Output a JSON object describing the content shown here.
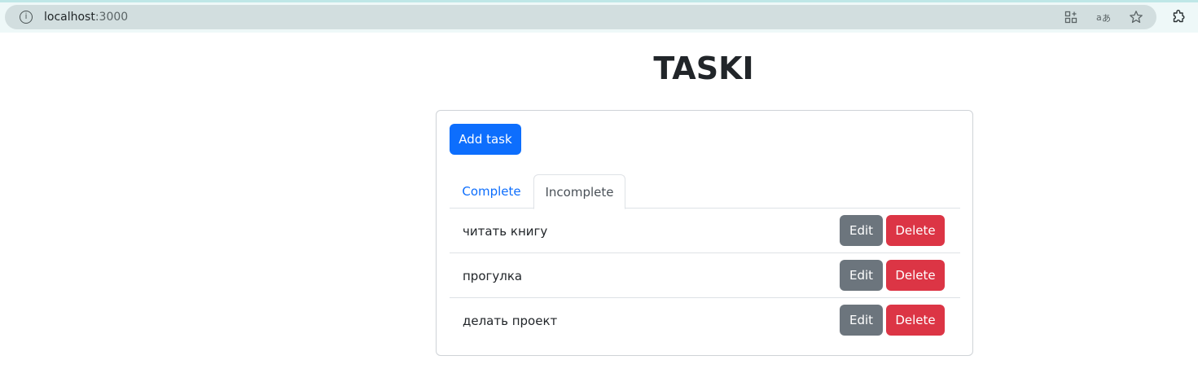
{
  "browser": {
    "url_host": "localhost",
    "url_port": ":3000",
    "icons": [
      "info-icon",
      "apps-icon",
      "translate-icon",
      "bookmark-star-icon",
      "extensions-icon"
    ]
  },
  "app": {
    "title": "TASKI",
    "add_button_label": "Add task"
  },
  "tabs": [
    {
      "label": "Complete",
      "active": false
    },
    {
      "label": "Incomplete",
      "active": true
    }
  ],
  "tasks": [
    {
      "title": "читать книгу",
      "edit_label": "Edit",
      "delete_label": "Delete"
    },
    {
      "title": "прогулка",
      "edit_label": "Edit",
      "delete_label": "Delete"
    },
    {
      "title": "делать проект",
      "edit_label": "Edit",
      "delete_label": "Delete"
    }
  ],
  "colors": {
    "primary": "#0d6efd",
    "secondary": "#6c757d",
    "danger": "#dc3545"
  }
}
